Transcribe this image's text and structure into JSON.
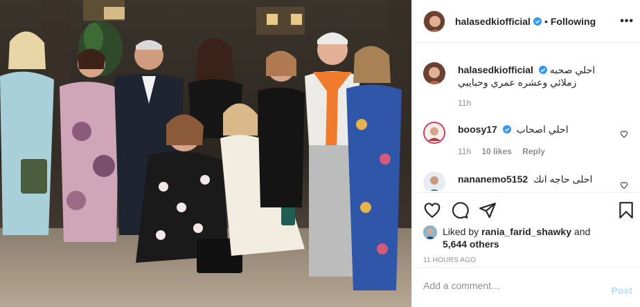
{
  "post": {
    "username": "halasedkiofficial",
    "separator": "•",
    "follow_label": "Following",
    "more_label": "•••"
  },
  "caption": {
    "username": "halasedkiofficial",
    "text": "احلي صحبه زملائي وعشره عمري وحبايبي",
    "age": "11h"
  },
  "comments": [
    {
      "username": "boosy17",
      "text": "احلي اصحاب",
      "age": "11h",
      "likes": "10 likes",
      "reply": "Reply"
    },
    {
      "username": "nananemo5152",
      "text": "احلى حاجه انك",
      "age": "",
      "likes": "",
      "reply": ""
    }
  ],
  "likes": {
    "prefix": "Liked by",
    "user": "rania_farid_shawky",
    "and": "and",
    "others": "5,644 others"
  },
  "timestamp": "11 HOURS AGO",
  "add_comment": {
    "placeholder": "Add a comment…",
    "post_label": "Post"
  },
  "icons": {
    "like": "heart-icon",
    "comment": "comment-icon",
    "share": "share-icon",
    "save": "bookmark-icon",
    "verified": "verified-badge-icon",
    "options": "more-options-icon"
  },
  "colors": {
    "verified": "#3897f0",
    "post_disabled": "#b2dffc",
    "muted": "#8e8e8e",
    "text": "#262626",
    "border": "#efefef"
  }
}
